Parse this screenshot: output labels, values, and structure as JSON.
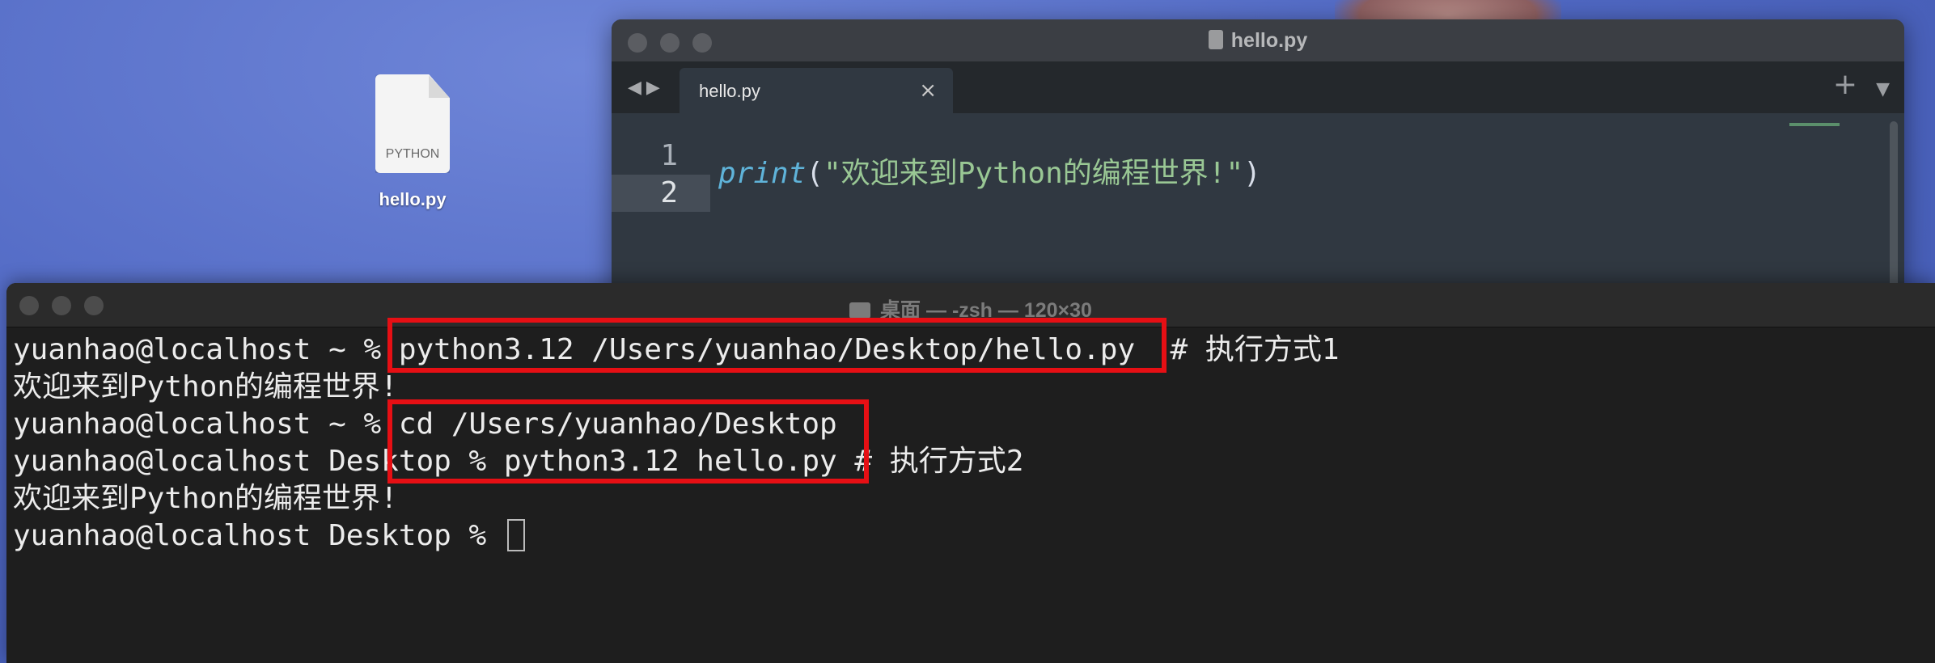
{
  "desktop": {
    "file_icon": {
      "type_label": "PYTHON",
      "name": "hello.py"
    }
  },
  "editor": {
    "window_title": "hello.py",
    "tab_label": "hello.py",
    "tab_close": "×",
    "new_tab": "+",
    "tab_menu": "▼",
    "nav": "◀▶",
    "line_numbers": [
      "1",
      "2"
    ],
    "code": {
      "func": "print",
      "open_paren": "(",
      "string": "\"欢迎来到Python的编程世界!\"",
      "close_paren": ")"
    }
  },
  "terminal": {
    "window_title": "桌面 — -zsh — 120×30",
    "lines": [
      {
        "prompt": "yuanhao@localhost ~ % ",
        "command": "python3.12 /Users/yuanhao/Desktop/hello.py",
        "comment": "  # 执行方式1"
      },
      {
        "output": "欢迎来到Python的编程世界!"
      },
      {
        "prompt": "yuanhao@localhost ~ % ",
        "command": "cd /Users/yuanhao/Desktop"
      },
      {
        "prompt": "yuanhao@localhost Desktop % ",
        "command": "python3.12 hello.py",
        "comment": " # 执行方式2"
      },
      {
        "output": "欢迎来到Python的编程世界!"
      },
      {
        "prompt": "yuanhao@localhost Desktop % "
      }
    ]
  },
  "colors": {
    "highlight_box": "#e60f14",
    "desktop_bg": "#5169c4",
    "terminal_bg": "#1e1e1e",
    "editor_bg": "#303841",
    "string_green": "#99c794",
    "keyword_blue": "#5fb3d9"
  }
}
